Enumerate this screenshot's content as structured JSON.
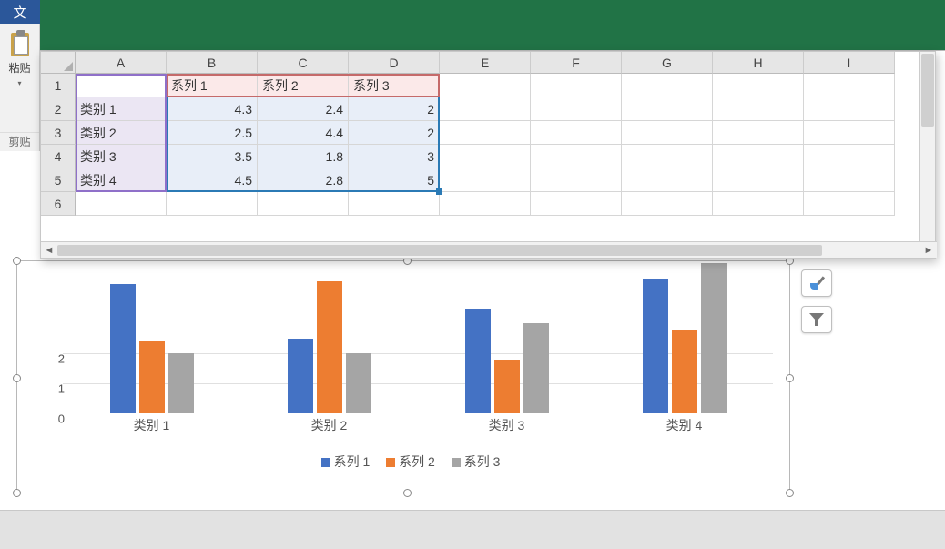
{
  "ribbon": {
    "file_tab": "文",
    "paste_label": "粘贴",
    "clipboard_section": "剪贴"
  },
  "columns": [
    "A",
    "B",
    "C",
    "D",
    "E",
    "F",
    "G",
    "H",
    "I"
  ],
  "rows": [
    "1",
    "2",
    "3",
    "4",
    "5",
    "6"
  ],
  "series_headers": [
    "系列 1",
    "系列 2",
    "系列 3"
  ],
  "cat_labels": [
    "类别 1",
    "类别 2",
    "类别 3",
    "类别 4"
  ],
  "data_display": [
    [
      "4.3",
      "2.4",
      "2"
    ],
    [
      "2.5",
      "4.4",
      "2"
    ],
    [
      "3.5",
      "1.8",
      "3"
    ],
    [
      "4.5",
      "2.8",
      "5"
    ]
  ],
  "side_buttons": {
    "style": "chart-styles-button",
    "filter": "chart-filter-button"
  },
  "legend": {
    "s1": "系列 1",
    "s2": "系列 2",
    "s3": "系列 3"
  },
  "chart_data": {
    "type": "bar",
    "categories": [
      "类别 1",
      "类别 2",
      "类别 3",
      "类别 4"
    ],
    "series": [
      {
        "name": "系列 1",
        "values": [
          4.3,
          2.5,
          3.5,
          4.5
        ],
        "color": "#4472c4"
      },
      {
        "name": "系列 2",
        "values": [
          2.4,
          4.4,
          1.8,
          2.8
        ],
        "color": "#ed7d31"
      },
      {
        "name": "系列 3",
        "values": [
          2,
          2,
          3,
          5
        ],
        "color": "#a5a5a5"
      }
    ],
    "ylim": [
      0,
      5
    ],
    "y_ticks_visible": [
      0,
      1,
      2
    ],
    "title": "",
    "xlabel": "",
    "ylabel": ""
  }
}
